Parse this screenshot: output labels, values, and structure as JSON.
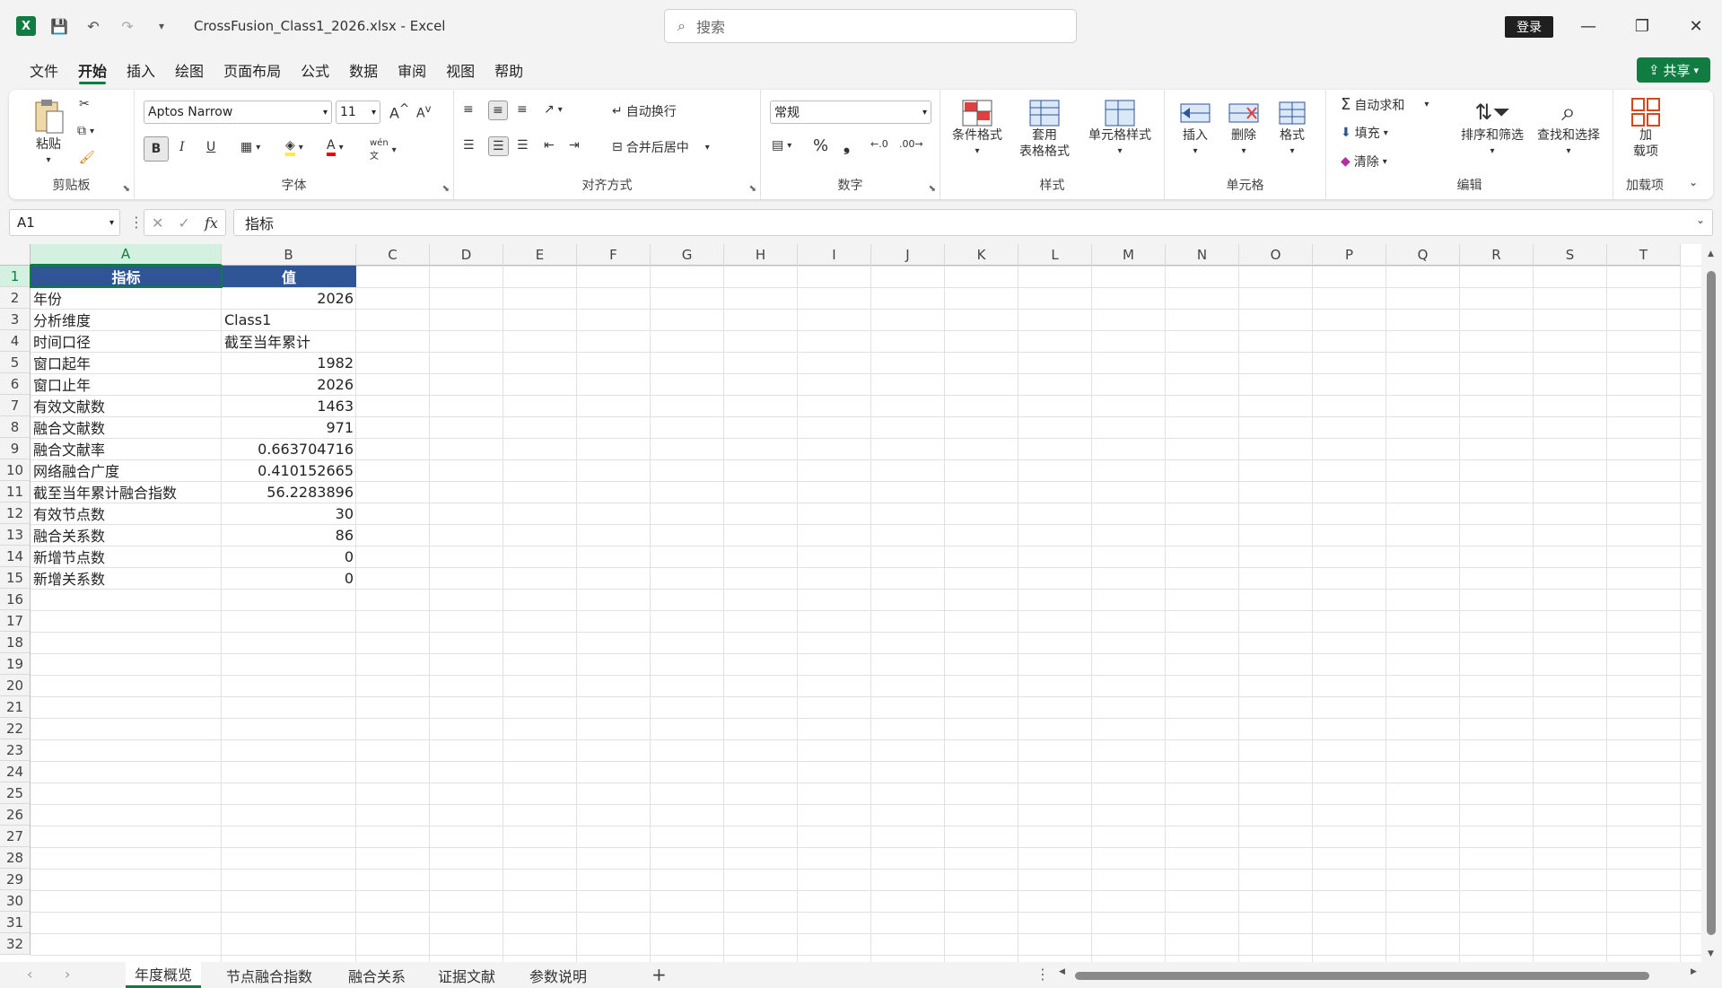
{
  "titlebar": {
    "filename": "CrossFusion_Class1_2026.xlsx  -  Excel",
    "search_placeholder": "搜索",
    "login": "登录"
  },
  "menu": [
    "文件",
    "开始",
    "插入",
    "绘图",
    "页面布局",
    "公式",
    "数据",
    "审阅",
    "视图",
    "帮助"
  ],
  "share": "共享",
  "ribbon": {
    "clipboard": {
      "label": "剪贴板",
      "paste": "粘贴"
    },
    "font": {
      "label": "字体",
      "family": "Aptos Narrow",
      "size": "11",
      "bold": "B",
      "italic": "I",
      "underline": "U"
    },
    "alignment": {
      "label": "对齐方式",
      "wrap": "自动换行",
      "merge": "合并后居中"
    },
    "number": {
      "label": "数字",
      "format": "常规",
      "percent": "%",
      "comma": "❟"
    },
    "styles": {
      "label": "样式",
      "conditional": "条件格式",
      "table_line1": "套用",
      "table_line2": "表格格式",
      "cell_styles": "单元格样式"
    },
    "cells": {
      "label": "单元格",
      "insert": "插入",
      "delete": "删除",
      "format": "格式"
    },
    "editing": {
      "label": "编辑",
      "autosum": "自动求和",
      "fill": "填充",
      "clear": "清除",
      "sort": "排序和筛选",
      "find": "查找和选择"
    },
    "addins": {
      "label": "加载项",
      "line1": "加",
      "line2": "载项"
    }
  },
  "formula_bar": {
    "name_box": "A1",
    "content": "指标"
  },
  "columns": [
    "A",
    "B",
    "C",
    "D",
    "E",
    "F",
    "G",
    "H",
    "I",
    "J",
    "K",
    "L",
    "M",
    "N",
    "O",
    "P",
    "Q",
    "R",
    "S",
    "T"
  ],
  "rows": [
    "1",
    "2",
    "3",
    "4",
    "5",
    "6",
    "7",
    "8",
    "9",
    "10",
    "11",
    "12",
    "13",
    "14",
    "15",
    "16",
    "17",
    "18",
    "19",
    "20",
    "21",
    "22",
    "23",
    "24",
    "25",
    "26",
    "27",
    "28",
    "29",
    "30",
    "31",
    "32"
  ],
  "table": {
    "headers": [
      "指标",
      "值"
    ],
    "rows": [
      [
        "年份",
        "2026"
      ],
      [
        "分析维度",
        "Class1"
      ],
      [
        "时间口径",
        "截至当年累计"
      ],
      [
        "窗口起年",
        "1982"
      ],
      [
        "窗口止年",
        "2026"
      ],
      [
        "有效文献数",
        "1463"
      ],
      [
        "融合文献数",
        "971"
      ],
      [
        "融合文献率",
        "0.663704716"
      ],
      [
        "网络融合广度",
        "0.410152665"
      ],
      [
        "截至当年累计融合指数",
        "56.2283896"
      ],
      [
        "有效节点数",
        "30"
      ],
      [
        "融合关系数",
        "86"
      ],
      [
        "新增节点数",
        "0"
      ],
      [
        "新增关系数",
        "0"
      ]
    ]
  },
  "sheet_tabs": [
    "年度概览",
    "节点融合指数",
    "融合关系",
    "证据文献",
    "参数说明"
  ],
  "colors": {
    "accent": "#107c41",
    "header_fill": "#2f5597"
  }
}
